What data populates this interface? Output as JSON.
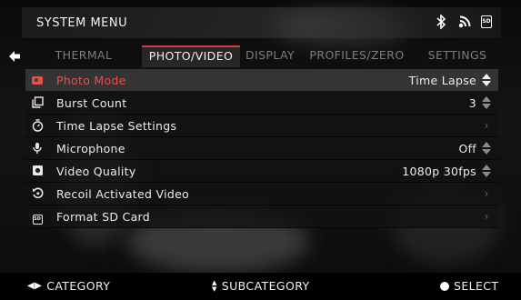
{
  "header": {
    "title": "SYSTEM MENU",
    "status_icons": [
      "bluetooth-icon",
      "wifi-icon",
      "sd-card-icon"
    ],
    "sd_label": "SD"
  },
  "tabs": [
    {
      "label": "THERMAL",
      "active": false
    },
    {
      "label": "PHOTO/VIDEO",
      "active": true
    },
    {
      "label": "DISPLAY",
      "active": false
    },
    {
      "label": "PROFILES/ZERO",
      "active": false
    },
    {
      "label": "SETTINGS",
      "active": false
    }
  ],
  "menu": {
    "items": [
      {
        "icon": "camera-icon",
        "label": "Photo Mode",
        "value": "Time Lapse",
        "control": "up-down",
        "active": true
      },
      {
        "icon": "burst-icon",
        "label": "Burst Count",
        "value": "3",
        "control": "up-down",
        "active": false
      },
      {
        "icon": "timer-icon",
        "label": "Time Lapse Settings",
        "value": "",
        "control": "chevron",
        "active": false
      },
      {
        "icon": "microphone-icon",
        "label": "Microphone",
        "value": "Off",
        "control": "up-down",
        "active": false
      },
      {
        "icon": "video-quality-icon",
        "label": "Video Quality",
        "value": "1080p 30fps",
        "control": "up-down",
        "active": false
      },
      {
        "icon": "recoil-icon",
        "label": "Recoil Activated Video",
        "value": "",
        "control": "chevron",
        "active": false
      },
      {
        "icon": "sd-card-icon",
        "label": "Format SD Card",
        "value": "",
        "control": "chevron",
        "active": false
      }
    ]
  },
  "footer": {
    "category": "CATEGORY",
    "subcategory": "SUBCATEGORY",
    "select": "SELECT"
  },
  "colors": {
    "accent": "#e2524f",
    "inactive_tab": "#7c7c7c"
  }
}
